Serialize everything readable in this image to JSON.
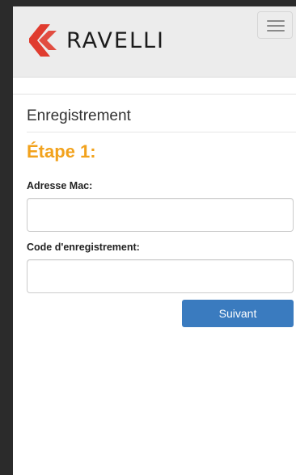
{
  "header": {
    "brand_name": "RAVELLI",
    "brand_color": "#e03c2f",
    "menu_icon": "hamburger-menu-icon"
  },
  "form": {
    "title": "Enregistrement",
    "step_title": "Étape 1:",
    "step_color": "#f2a21c",
    "mac_label": "Adresse Mac:",
    "mac_value": "",
    "code_label": "Code d'enregistrement:",
    "code_value": "",
    "next_button_label": "Suivant",
    "button_color": "#3a7bbf"
  }
}
